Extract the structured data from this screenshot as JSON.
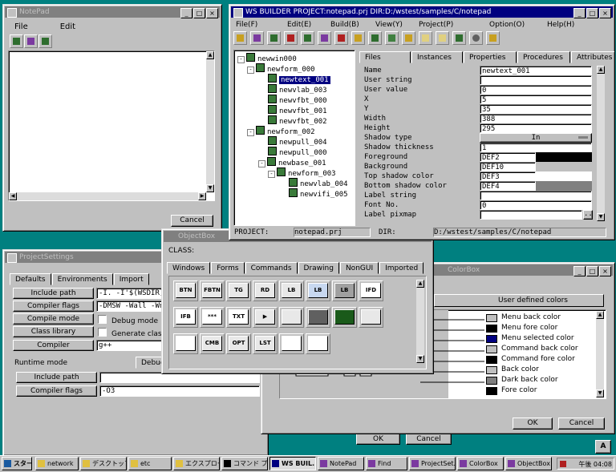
{
  "notepad": {
    "title": "NotePad",
    "menu": [
      "File",
      "Edit"
    ],
    "cancel": "Cancel"
  },
  "builder": {
    "title": "WS BUILDER PROJECT:notepad.prj DIR:D:/wstest/samples/C/notepad",
    "menu": [
      "File(F)",
      "Edit(E)",
      "Build(B)",
      "View(Y)",
      "Project(P)",
      "Option(O)",
      "Help(H)"
    ],
    "tabs": [
      "Files",
      "Instances",
      "Properties",
      "Procedures",
      "Attributes"
    ],
    "tree": [
      {
        "label": "newwin000",
        "depth": 0,
        "exp": "-"
      },
      {
        "label": "newform_000",
        "depth": 1,
        "exp": "-"
      },
      {
        "label": "newtext_001",
        "depth": 2,
        "exp": "",
        "selected": true
      },
      {
        "label": "newvlab_003",
        "depth": 2,
        "exp": ""
      },
      {
        "label": "newvfbt_000",
        "depth": 2,
        "exp": ""
      },
      {
        "label": "newvfbt_001",
        "depth": 2,
        "exp": ""
      },
      {
        "label": "newvfbt_002",
        "depth": 2,
        "exp": ""
      },
      {
        "label": "newform_002",
        "depth": 1,
        "exp": "-"
      },
      {
        "label": "newpull_004",
        "depth": 2,
        "exp": ""
      },
      {
        "label": "newpull_000",
        "depth": 2,
        "exp": ""
      },
      {
        "label": "newbase_001",
        "depth": 2,
        "exp": "-"
      },
      {
        "label": "newform_003",
        "depth": 3,
        "exp": "-"
      },
      {
        "label": "newvlab_004",
        "depth": 4,
        "exp": ""
      },
      {
        "label": "newvifi_005",
        "depth": 4,
        "exp": ""
      }
    ],
    "props": [
      {
        "name": "Name",
        "value": "newtext_001"
      },
      {
        "name": "User string",
        "value": ""
      },
      {
        "name": "User value",
        "value": "0"
      },
      {
        "name": "X",
        "value": "5"
      },
      {
        "name": "Y",
        "value": "35"
      },
      {
        "name": "Width",
        "value": "388"
      },
      {
        "name": "Height",
        "value": "295"
      },
      {
        "name": "Shadow type",
        "value": "In"
      },
      {
        "name": "Shadow thickness",
        "value": "1"
      },
      {
        "name": "Foreground",
        "value": "DEF2",
        "swatch": "#000000"
      },
      {
        "name": "Background",
        "value": "DEF10",
        "swatch": "#c0c0c0"
      },
      {
        "name": "Top shadow color",
        "value": "DEF3",
        "swatch": "#ffffff"
      },
      {
        "name": "Bottom shadow color",
        "value": "DEF4",
        "swatch": "#808080"
      },
      {
        "name": "Label string",
        "value": ""
      },
      {
        "name": "Font No.",
        "value": "0"
      },
      {
        "name": "Label pixmap",
        "value": ""
      }
    ],
    "status": {
      "project_label": "PROJECT:",
      "project": "notepad.prj",
      "dir_label": "DIR:",
      "dir": "D:/wstest/samples/C/notepad"
    }
  },
  "objectbox": {
    "title": "ObjectBox",
    "class_label": "CLASS:",
    "tabs": [
      "Windows",
      "Forms",
      "Commands",
      "Drawing",
      "NonGUI",
      "Imported"
    ],
    "row1": [
      "BTN",
      "FBTN",
      "TG",
      "RD",
      "LB",
      "LB",
      "LB",
      "IFD"
    ],
    "row2": [
      "IFB",
      "***",
      "TXT",
      "▶",
      "",
      "",
      "",
      ""
    ],
    "row3": [
      "",
      "CMB",
      "OPT",
      "LST",
      "",
      ""
    ]
  },
  "projectsettings": {
    "title": "ProjectSettings",
    "tabs": [
      "Defaults",
      "Environments",
      "Import"
    ],
    "rows": [
      {
        "button": "Include path",
        "value": "-I. -I'$(WSDIR)/i"
      },
      {
        "button": "Compiler flags",
        "value": "-DMSW -Wall -Wno-"
      },
      {
        "button": "Compile mode",
        "check": "Debug mode"
      },
      {
        "button": "Class library",
        "check": "Generate class"
      },
      {
        "button": "Compiler",
        "value": "g++"
      }
    ],
    "runtime_label": "Runtime mode",
    "debug_tab": "Debug",
    "runtime_rows": [
      {
        "button": "Include path",
        "value": ""
      },
      {
        "button": "Compiler flags",
        "value": "-O3"
      }
    ],
    "ok": "OK",
    "cancel": "Cancel"
  },
  "colorbox": {
    "title": "ColorBox",
    "col2": "User defined colors",
    "colors": [
      {
        "label": "Menu back color",
        "swatch": "#c0c0c0"
      },
      {
        "label": "Menu fore color",
        "swatch": "#000000"
      },
      {
        "label": "Menu selected color",
        "swatch": "#000080"
      },
      {
        "label": "Command back color",
        "swatch": "#c0c0c0"
      },
      {
        "label": "Command fore color",
        "swatch": "#000000"
      },
      {
        "label": "Back color",
        "swatch": "#c0c0c0"
      },
      {
        "label": "Dark back color",
        "swatch": "#808080"
      },
      {
        "label": "Fore color",
        "swatch": "#000000"
      }
    ],
    "ok": "OK",
    "cancel": "Cancel"
  },
  "taskbar": {
    "start": "スタート",
    "items": [
      "network",
      "デスクトップ",
      "etc",
      "エクスプローラ...",
      "コマンド プロ...",
      "WS BUIL...",
      "NotePad",
      "Find",
      "ProjectSet...",
      "ColorBox",
      "ObjectBox"
    ],
    "clock": "午後 04:08"
  }
}
